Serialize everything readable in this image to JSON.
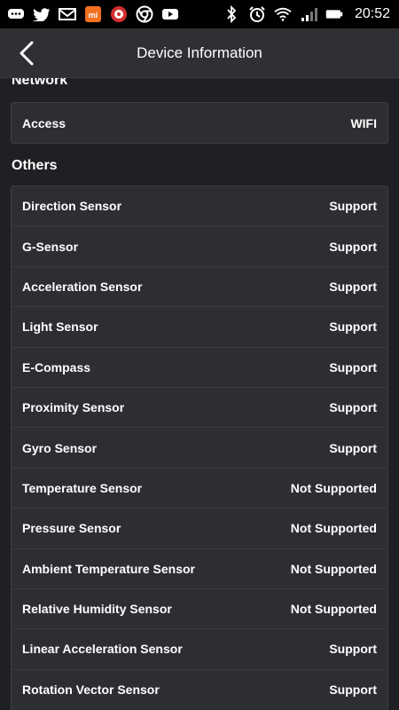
{
  "status_bar": {
    "time": "20:52",
    "left_icons": [
      "chat-icon",
      "twitter-icon",
      "mail-icon",
      "mi-app-icon",
      "game-icon",
      "chrome-icon",
      "youtube-icon"
    ],
    "right_icons": [
      "bluetooth-icon",
      "alarm-icon",
      "wifi-icon",
      "signal-icon",
      "battery-icon"
    ]
  },
  "header": {
    "title": "Device Information"
  },
  "network": {
    "title": "Network",
    "rows": [
      {
        "label": "Access",
        "value": "WIFI"
      }
    ]
  },
  "others": {
    "title": "Others",
    "rows": [
      {
        "label": "Direction Sensor",
        "value": "Support"
      },
      {
        "label": "G-Sensor",
        "value": "Support"
      },
      {
        "label": "Acceleration Sensor",
        "value": "Support"
      },
      {
        "label": "Light Sensor",
        "value": "Support"
      },
      {
        "label": "E-Compass",
        "value": "Support"
      },
      {
        "label": "Proximity Sensor",
        "value": "Support"
      },
      {
        "label": "Gyro Sensor",
        "value": "Support"
      },
      {
        "label": "Temperature Sensor",
        "value": "Not Supported"
      },
      {
        "label": "Pressure Sensor",
        "value": "Not Supported"
      },
      {
        "label": "Ambient Temperature Sensor",
        "value": "Not Supported"
      },
      {
        "label": "Relative Humidity Sensor",
        "value": "Not Supported"
      },
      {
        "label": "Linear Acceleration Sensor",
        "value": "Support"
      },
      {
        "label": "Rotation Vector Sensor",
        "value": "Support"
      }
    ]
  }
}
